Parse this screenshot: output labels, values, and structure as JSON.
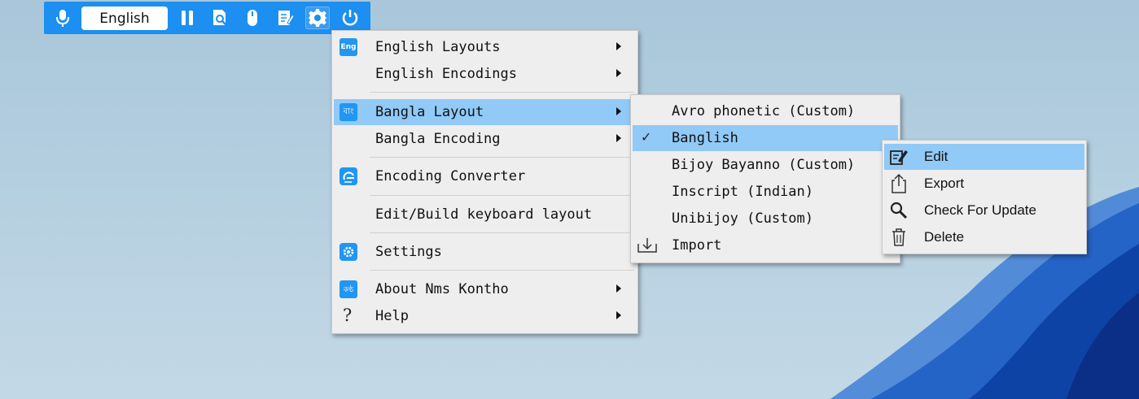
{
  "toolbar": {
    "language": "English",
    "buttons": [
      "microphone-icon",
      "pause-icon",
      "search-doc-icon",
      "mouse-icon",
      "notepad-icon",
      "gear-icon",
      "power-icon"
    ]
  },
  "main_menu": {
    "items": [
      {
        "label": "English Layouts",
        "icon": "eng-icon",
        "submenu": true
      },
      {
        "label": "English Encodings",
        "submenu": true
      },
      {
        "label": "Bangla Layout",
        "icon": "bangla-icon",
        "submenu": true,
        "highlighted": true
      },
      {
        "label": "Bangla Encoding",
        "submenu": true
      },
      {
        "label": "Encoding Converter",
        "icon": "converter-icon"
      },
      {
        "label": "Edit/Build keyboard layout"
      },
      {
        "label": "Settings",
        "icon": "settings-icon"
      },
      {
        "label": "About Nms Kontho",
        "icon": "kontho-icon",
        "submenu": true
      },
      {
        "label": "Help",
        "icon": "question-icon",
        "submenu": true
      }
    ],
    "icon_text": {
      "eng": "Eng",
      "bangla": "বাং",
      "kontho": "কণ্ঠ",
      "question": "?"
    }
  },
  "layout_menu": {
    "items": [
      {
        "label": "Avro phonetic (Custom)"
      },
      {
        "label": "Banglish",
        "checked": true,
        "highlighted": true
      },
      {
        "label": "Bijoy Bayanno (Custom)"
      },
      {
        "label": "Inscript (Indian)"
      },
      {
        "label": "Unibijoy (Custom)"
      },
      {
        "label": "Import",
        "icon": "import-icon"
      }
    ],
    "check_mark": "✓"
  },
  "action_menu": {
    "items": [
      {
        "label": "Edit",
        "icon": "edit-icon",
        "highlighted": true
      },
      {
        "label": "Export",
        "icon": "export-icon"
      },
      {
        "label": "Check For Update",
        "icon": "magnifier-icon"
      },
      {
        "label": "Delete",
        "icon": "trash-icon"
      }
    ]
  },
  "colors": {
    "toolbar": "#1c8ff0",
    "highlight": "#91c9f7",
    "menu_bg": "#eeeeee",
    "icon_blue": "#2196f3"
  }
}
